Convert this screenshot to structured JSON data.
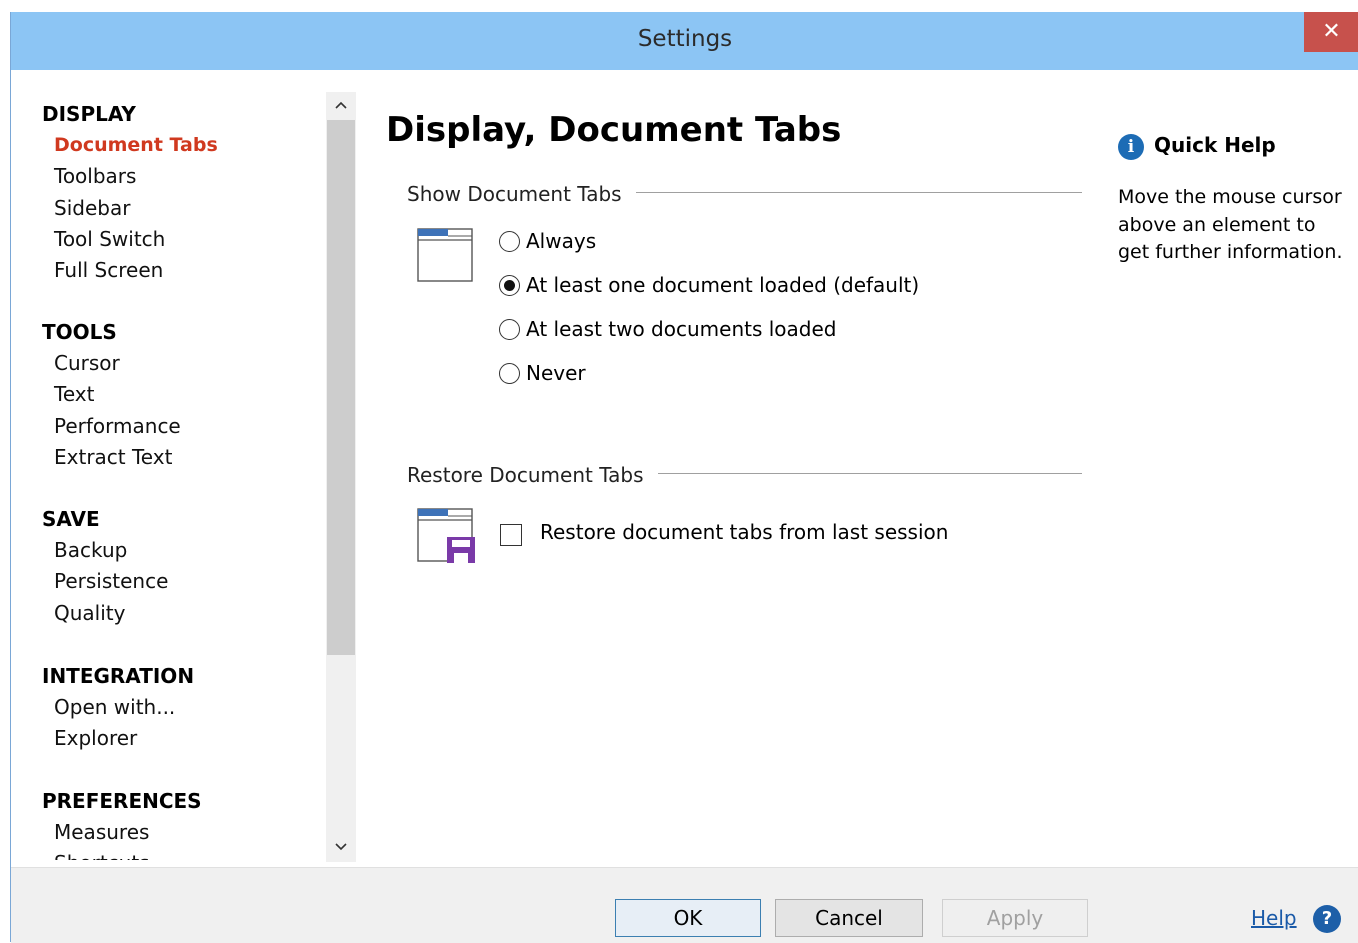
{
  "window": {
    "title": "Settings",
    "close_glyph": "✕"
  },
  "nav": {
    "sections": [
      {
        "heading": "DISPLAY",
        "items": [
          "Document Tabs",
          "Toolbars",
          "Sidebar",
          "Tool Switch",
          "Full Screen"
        ],
        "active": "Document Tabs"
      },
      {
        "heading": "TOOLS",
        "items": [
          "Cursor",
          "Text",
          "Performance",
          "Extract Text"
        ]
      },
      {
        "heading": "SAVE",
        "items": [
          "Backup",
          "Persistence",
          "Quality"
        ]
      },
      {
        "heading": "INTEGRATION",
        "items": [
          "Open with...",
          "Explorer"
        ]
      },
      {
        "heading": "PREFERENCES",
        "items": [
          "Measures",
          "Shortcuts"
        ]
      }
    ],
    "scroll_up_glyph": "^",
    "scroll_down_glyph": "v"
  },
  "main": {
    "title": "Display, Document Tabs",
    "show_group": {
      "label": "Show Document Tabs",
      "icon": "tabbed-window-icon",
      "options": [
        "Always",
        "At least one document loaded (default)",
        "At least two documents loaded",
        "Never"
      ],
      "selected": "At least one document loaded (default)"
    },
    "restore_group": {
      "label": "Restore Document Tabs",
      "icon": "tabbed-window-save-icon",
      "checkbox_label": "Restore document tabs from last session",
      "checked": false
    }
  },
  "quick_help": {
    "icon_glyph": "i",
    "title": "Quick Help",
    "text": "Move the mouse cursor above an element to get further information."
  },
  "footer": {
    "ok": "OK",
    "cancel": "Cancel",
    "apply": "Apply",
    "help": "Help",
    "help_icon_glyph": "?"
  },
  "colors": {
    "titlebar": "#8cc5f4",
    "close": "#c7514c",
    "active_nav": "#d0391f",
    "accent": "#1d6cb5",
    "save_icon": "#7a3aa8"
  }
}
